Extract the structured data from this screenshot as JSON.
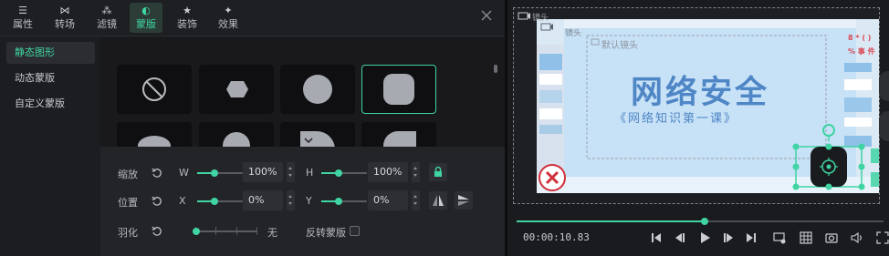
{
  "tabs": [
    {
      "label": "属性",
      "icon": "sliders-icon"
    },
    {
      "label": "转场",
      "icon": "transition-icon"
    },
    {
      "label": "滤镜",
      "icon": "filter-icon"
    },
    {
      "label": "蒙版",
      "icon": "mask-icon",
      "active": true
    },
    {
      "label": "装饰",
      "icon": "star-icon"
    },
    {
      "label": "效果",
      "icon": "sparkle-icon"
    }
  ],
  "sidebar": {
    "items": [
      {
        "label": "静态图形",
        "active": true
      },
      {
        "label": "动态蒙版"
      },
      {
        "label": "自定义蒙版"
      }
    ]
  },
  "shapes": [
    "none",
    "hexagon",
    "circle",
    "rounded-square",
    "semicircle",
    "circle",
    "quarter",
    "rounded-corner"
  ],
  "props": {
    "scale_label": "缩放",
    "position_label": "位置",
    "feather_label": "羽化",
    "w_label": "W",
    "h_label": "H",
    "x_label": "X",
    "y_label": "Y",
    "w_value": "100%",
    "h_value": "100%",
    "x_value": "0%",
    "y_value": "0%",
    "feather_value": "无",
    "invert_label": "反转蒙版"
  },
  "preview": {
    "default_shot_label": "默认镜头",
    "shot_label": "镜头",
    "title": "网络安全",
    "subtitle": "《网络知识第一课》",
    "side_text_1": "8 * ( )",
    "side_text_2": "% 事 件"
  },
  "player": {
    "timecode": "00:00:10.83",
    "progress_percent": 51
  },
  "colors": {
    "accent": "#3fd4a2",
    "title_blue": "#4f86c6",
    "preview_bg": "#c6e2f5"
  }
}
